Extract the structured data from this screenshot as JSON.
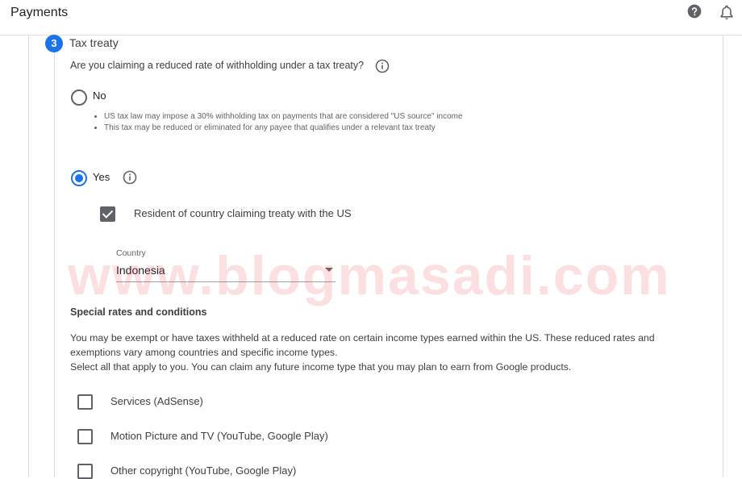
{
  "header": {
    "title": "Payments",
    "help_icon": "help-icon",
    "notification_icon": "bell-icon"
  },
  "step": {
    "number": "3",
    "title": "Tax treaty"
  },
  "question": "Are you claiming a reduced rate of withholding under a tax treaty?",
  "options": {
    "no": {
      "label": "No",
      "selected": false,
      "notes": [
        "US tax law may impose a 30% withholding tax on payments that are considered \"US source\" income",
        "This tax may be reduced or eliminated for any payee that qualifies under a relevant tax treaty"
      ]
    },
    "yes": {
      "label": "Yes",
      "selected": true
    }
  },
  "resident_checkbox": {
    "label": "Resident of country claiming treaty with the US",
    "checked": true
  },
  "country": {
    "label": "Country",
    "value": "Indonesia"
  },
  "special_rates": {
    "heading": "Special rates and conditions",
    "paragraph_lines": [
      "You may be exempt or have taxes withheld at a reduced rate on certain income types earned within the US. These reduced rates and",
      "exemptions vary among countries and specific income types.",
      "Select all that apply to you. You can claim any future income type that you may plan to earn from Google products."
    ],
    "income_types": [
      {
        "label": "Services (AdSense)",
        "checked": false
      },
      {
        "label": "Motion Picture and TV (YouTube, Google Play)",
        "checked": false
      },
      {
        "label": "Other copyright (YouTube, Google Play)",
        "checked": false
      }
    ]
  },
  "watermark": "www.blogmasadi.com",
  "colors": {
    "accent": "#1a73e8",
    "text": "#202124",
    "muted": "#5f6368",
    "watermark": "#eb505a"
  }
}
